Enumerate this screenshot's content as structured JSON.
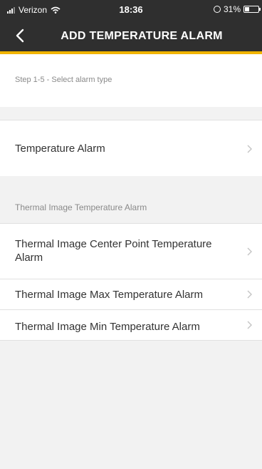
{
  "status_bar": {
    "carrier": "Verizon",
    "time": "18:36",
    "battery": "31%",
    "battery_level": 0.31
  },
  "nav": {
    "title": "ADD TEMPERATURE ALARM",
    "back_icon": "chevron-left-icon"
  },
  "step_text": "Step 1-5 - Select alarm type",
  "rows": {
    "temperature_alarm": "Temperature Alarm"
  },
  "section": {
    "title": "Thermal Image Temperature Alarm",
    "items": [
      "Thermal Image Center Point Temperature Alarm",
      "Thermal Image Max Temperature Alarm",
      "Thermal Image Min Temperature Alarm"
    ]
  },
  "colors": {
    "header_bg": "#2f2f2f",
    "accent": "#f0b400",
    "background": "#f2f2f2"
  }
}
